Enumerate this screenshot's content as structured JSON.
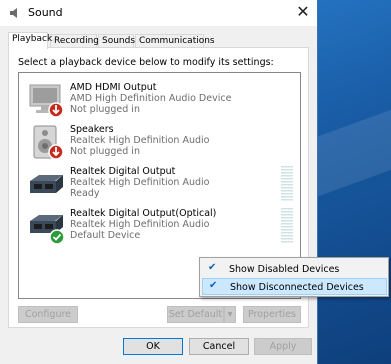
{
  "window": {
    "title": "Sound",
    "close_symbol": "✕"
  },
  "tabs": [
    {
      "label": "Playback"
    },
    {
      "label": "Recording"
    },
    {
      "label": "Sounds"
    },
    {
      "label": "Communications"
    }
  ],
  "instruction": "Select a playback device below to modify its settings:",
  "devices": [
    {
      "name": "AMD HDMI Output",
      "description": "AMD High Definition Audio Device",
      "status": "Not plugged in",
      "icon": "monitor-icon",
      "badge": "unplugged"
    },
    {
      "name": "Speakers",
      "description": "Realtek High Definition Audio",
      "status": "Not plugged in",
      "icon": "speaker-icon",
      "badge": "unplugged"
    },
    {
      "name": "Realtek Digital Output",
      "description": "Realtek High Definition Audio",
      "status": "Ready",
      "icon": "digital-output-icon",
      "badge": "none"
    },
    {
      "name": "Realtek Digital Output(Optical)",
      "description": "Realtek High Definition Audio",
      "status": "Default Device",
      "icon": "digital-output-icon",
      "badge": "default"
    }
  ],
  "context_menu": {
    "items": [
      {
        "label": "Show Disabled Devices",
        "checked": true
      },
      {
        "label": "Show Disconnected Devices",
        "checked": true
      }
    ]
  },
  "buttons": {
    "configure": "Configure",
    "set_default": "Set Default",
    "properties": "Properties",
    "ok": "OK",
    "cancel": "Cancel",
    "apply": "Apply"
  },
  "colors": {
    "accent": "#0078d7",
    "unplugged_badge": "#c42b1c",
    "default_badge": "#2d9d3a",
    "menu_highlight": "#cce8ff"
  }
}
